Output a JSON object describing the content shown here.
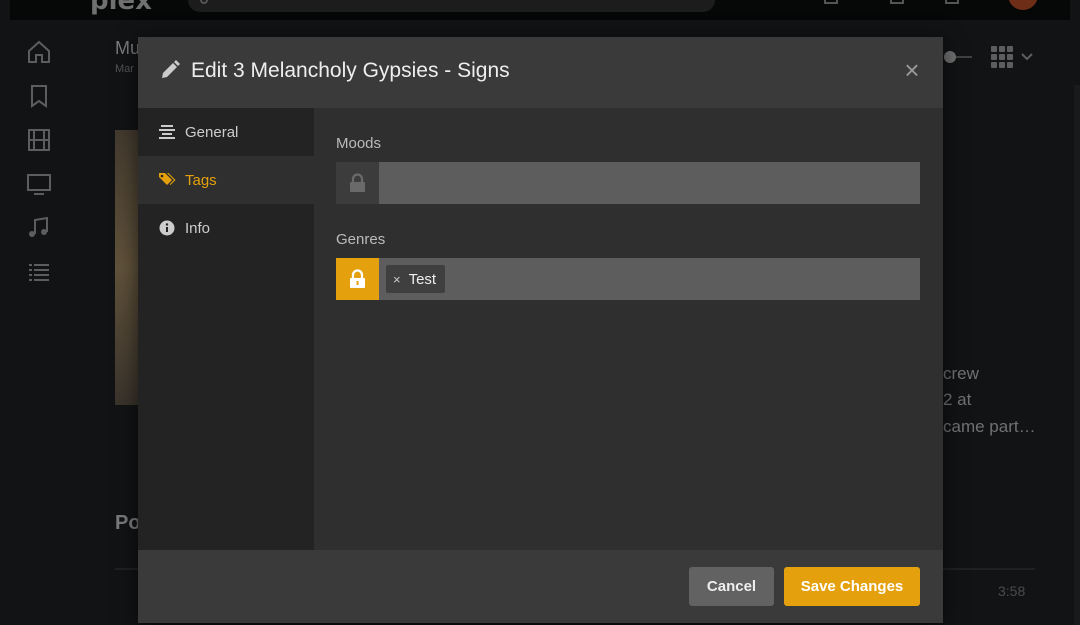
{
  "app": {
    "logo": "plex"
  },
  "background": {
    "title": "Mu",
    "subtitle": "Mar",
    "section_heading": "Po",
    "bio_lines": [
      "crew",
      "2 at",
      "came part…"
    ],
    "duration": "3:58"
  },
  "modal": {
    "title": "Edit 3 Melancholy Gypsies - Signs",
    "close_label": "×",
    "nav": [
      {
        "label": "General",
        "icon": "align-center-icon",
        "active": false
      },
      {
        "label": "Tags",
        "icon": "tags-icon",
        "active": true
      },
      {
        "label": "Info",
        "icon": "info-circle-icon",
        "active": false
      }
    ],
    "fields": {
      "moods": {
        "label": "Moods",
        "locked": false,
        "tags": []
      },
      "genres": {
        "label": "Genres",
        "locked": true,
        "tags": [
          {
            "remove": "×",
            "label": "Test"
          }
        ]
      }
    },
    "footer": {
      "cancel_label": "Cancel",
      "save_label": "Save Changes"
    }
  },
  "colors": {
    "accent": "#e5a00d",
    "modal_bg": "#2f2f2f",
    "input_bg": "#5d5d5d"
  }
}
